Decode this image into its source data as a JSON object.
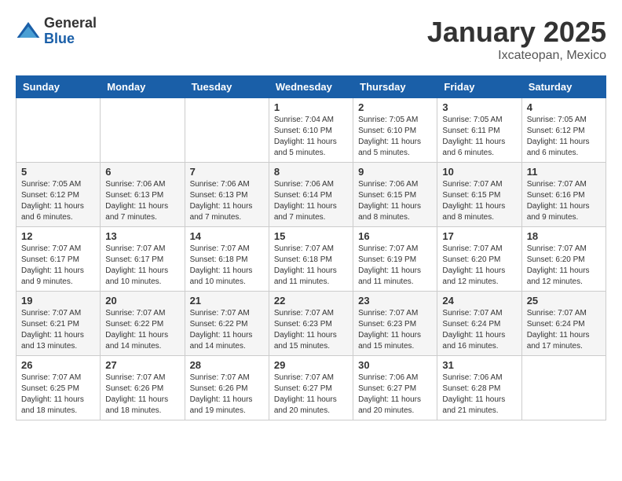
{
  "logo": {
    "general": "General",
    "blue": "Blue"
  },
  "title": "January 2025",
  "location": "Ixcateopan, Mexico",
  "days_header": [
    "Sunday",
    "Monday",
    "Tuesday",
    "Wednesday",
    "Thursday",
    "Friday",
    "Saturday"
  ],
  "weeks": [
    [
      {
        "day": "",
        "info": ""
      },
      {
        "day": "",
        "info": ""
      },
      {
        "day": "",
        "info": ""
      },
      {
        "day": "1",
        "info": "Sunrise: 7:04 AM\nSunset: 6:10 PM\nDaylight: 11 hours\nand 5 minutes."
      },
      {
        "day": "2",
        "info": "Sunrise: 7:05 AM\nSunset: 6:10 PM\nDaylight: 11 hours\nand 5 minutes."
      },
      {
        "day": "3",
        "info": "Sunrise: 7:05 AM\nSunset: 6:11 PM\nDaylight: 11 hours\nand 6 minutes."
      },
      {
        "day": "4",
        "info": "Sunrise: 7:05 AM\nSunset: 6:12 PM\nDaylight: 11 hours\nand 6 minutes."
      }
    ],
    [
      {
        "day": "5",
        "info": "Sunrise: 7:05 AM\nSunset: 6:12 PM\nDaylight: 11 hours\nand 6 minutes."
      },
      {
        "day": "6",
        "info": "Sunrise: 7:06 AM\nSunset: 6:13 PM\nDaylight: 11 hours\nand 7 minutes."
      },
      {
        "day": "7",
        "info": "Sunrise: 7:06 AM\nSunset: 6:13 PM\nDaylight: 11 hours\nand 7 minutes."
      },
      {
        "day": "8",
        "info": "Sunrise: 7:06 AM\nSunset: 6:14 PM\nDaylight: 11 hours\nand 7 minutes."
      },
      {
        "day": "9",
        "info": "Sunrise: 7:06 AM\nSunset: 6:15 PM\nDaylight: 11 hours\nand 8 minutes."
      },
      {
        "day": "10",
        "info": "Sunrise: 7:07 AM\nSunset: 6:15 PM\nDaylight: 11 hours\nand 8 minutes."
      },
      {
        "day": "11",
        "info": "Sunrise: 7:07 AM\nSunset: 6:16 PM\nDaylight: 11 hours\nand 9 minutes."
      }
    ],
    [
      {
        "day": "12",
        "info": "Sunrise: 7:07 AM\nSunset: 6:17 PM\nDaylight: 11 hours\nand 9 minutes."
      },
      {
        "day": "13",
        "info": "Sunrise: 7:07 AM\nSunset: 6:17 PM\nDaylight: 11 hours\nand 10 minutes."
      },
      {
        "day": "14",
        "info": "Sunrise: 7:07 AM\nSunset: 6:18 PM\nDaylight: 11 hours\nand 10 minutes."
      },
      {
        "day": "15",
        "info": "Sunrise: 7:07 AM\nSunset: 6:18 PM\nDaylight: 11 hours\nand 11 minutes."
      },
      {
        "day": "16",
        "info": "Sunrise: 7:07 AM\nSunset: 6:19 PM\nDaylight: 11 hours\nand 11 minutes."
      },
      {
        "day": "17",
        "info": "Sunrise: 7:07 AM\nSunset: 6:20 PM\nDaylight: 11 hours\nand 12 minutes."
      },
      {
        "day": "18",
        "info": "Sunrise: 7:07 AM\nSunset: 6:20 PM\nDaylight: 11 hours\nand 12 minutes."
      }
    ],
    [
      {
        "day": "19",
        "info": "Sunrise: 7:07 AM\nSunset: 6:21 PM\nDaylight: 11 hours\nand 13 minutes."
      },
      {
        "day": "20",
        "info": "Sunrise: 7:07 AM\nSunset: 6:22 PM\nDaylight: 11 hours\nand 14 minutes."
      },
      {
        "day": "21",
        "info": "Sunrise: 7:07 AM\nSunset: 6:22 PM\nDaylight: 11 hours\nand 14 minutes."
      },
      {
        "day": "22",
        "info": "Sunrise: 7:07 AM\nSunset: 6:23 PM\nDaylight: 11 hours\nand 15 minutes."
      },
      {
        "day": "23",
        "info": "Sunrise: 7:07 AM\nSunset: 6:23 PM\nDaylight: 11 hours\nand 15 minutes."
      },
      {
        "day": "24",
        "info": "Sunrise: 7:07 AM\nSunset: 6:24 PM\nDaylight: 11 hours\nand 16 minutes."
      },
      {
        "day": "25",
        "info": "Sunrise: 7:07 AM\nSunset: 6:24 PM\nDaylight: 11 hours\nand 17 minutes."
      }
    ],
    [
      {
        "day": "26",
        "info": "Sunrise: 7:07 AM\nSunset: 6:25 PM\nDaylight: 11 hours\nand 18 minutes."
      },
      {
        "day": "27",
        "info": "Sunrise: 7:07 AM\nSunset: 6:26 PM\nDaylight: 11 hours\nand 18 minutes."
      },
      {
        "day": "28",
        "info": "Sunrise: 7:07 AM\nSunset: 6:26 PM\nDaylight: 11 hours\nand 19 minutes."
      },
      {
        "day": "29",
        "info": "Sunrise: 7:07 AM\nSunset: 6:27 PM\nDaylight: 11 hours\nand 20 minutes."
      },
      {
        "day": "30",
        "info": "Sunrise: 7:06 AM\nSunset: 6:27 PM\nDaylight: 11 hours\nand 20 minutes."
      },
      {
        "day": "31",
        "info": "Sunrise: 7:06 AM\nSunset: 6:28 PM\nDaylight: 11 hours\nand 21 minutes."
      },
      {
        "day": "",
        "info": ""
      }
    ]
  ]
}
